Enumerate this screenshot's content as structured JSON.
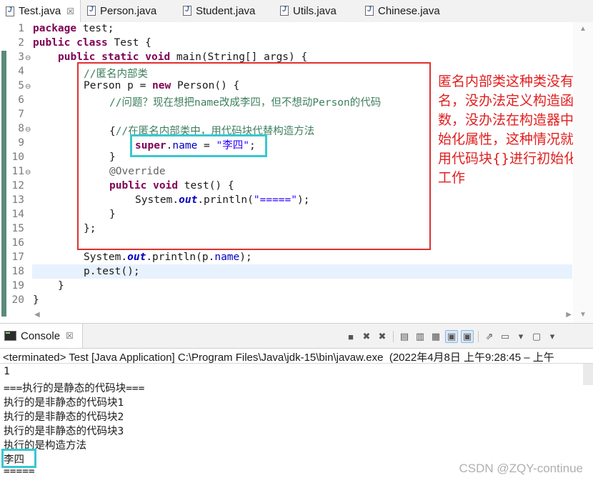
{
  "editor_tabs": [
    {
      "label": "Test.java",
      "active": true,
      "close": "☒"
    },
    {
      "label": "Person.java"
    },
    {
      "label": "Student.java"
    },
    {
      "label": "Utils.java"
    },
    {
      "label": "Chinese.java"
    }
  ],
  "line_numbers": [
    "1",
    "2",
    "3",
    "4",
    "5",
    "6",
    "7",
    "8",
    "9",
    "10",
    "11",
    "12",
    "13",
    "14",
    "15",
    "16",
    "17",
    "18",
    "19",
    "20"
  ],
  "code": {
    "l1_kw": "package",
    "l1_rest": " test;",
    "l2_kw1": "public",
    "l2_kw2": "class",
    "l2_rest": " Test {",
    "l3_kw1": "public",
    "l3_kw2": "static",
    "l3_kw3": "void",
    "l3_rest": " main(String[] args) {",
    "l4_comment": "//匿名内部类",
    "l5_a": "Person p = ",
    "l5_kw": "new",
    "l5_b": " Person() {",
    "l6_comment": "//问题？现在想把name改成李四，但不想动Person的代码",
    "l8_brace": "{",
    "l8_comment": "//在匿名内部类中，用代码块代替构造方法",
    "l9_kw": "super",
    "l9_dot": ".",
    "l9_field": "name",
    "l9_eq": " = ",
    "l9_str": "\"李四\"",
    "l9_end": ";",
    "l10": "}",
    "l11_annotation": "@Override",
    "l12_kw1": "public",
    "l12_kw2": "void",
    "l12_rest": " test() {",
    "l13_a": "System.",
    "l13_field": "out",
    "l13_b": ".println(",
    "l13_str": "\"=====\"",
    "l13_c": ");",
    "l14": "}",
    "l15": "};",
    "l17_a": "System.",
    "l17_field": "out",
    "l17_b": ".println(p.",
    "l17_field2": "name",
    "l17_c": ");",
    "l18": "p.test();",
    "l19": "}",
    "l20": "}"
  },
  "annotation_text": "匿名内部类这种类没有类名，没办法定义构造函数，没办法在构造器中初始化属性，这种情况就要用代码块{}进行初始化工作",
  "console": {
    "tab_label": "Console",
    "tab_close": "☒",
    "status": "<terminated> Test [Java Application] C:\\Program Files\\Java\\jdk-15\\bin\\javaw.exe  (2022年4月8日 上午9:28:45 – 上午",
    "output": [
      "1",
      "===执行的是静态的代码块===",
      "执行的是非静态的代码块1",
      "执行的是非静态的代码块2",
      "执行的是非静态的代码块3",
      "执行的是构造方法",
      "李四",
      "====="
    ]
  },
  "watermark": "CSDN @ZQY-continue",
  "colors": {
    "keyword": "#7f0055",
    "comment": "#3f7f5f",
    "string": "#2a00ff",
    "field": "#0000c0",
    "annotation_red": "#e02020",
    "highlight_cyan": "#38c8d0"
  }
}
